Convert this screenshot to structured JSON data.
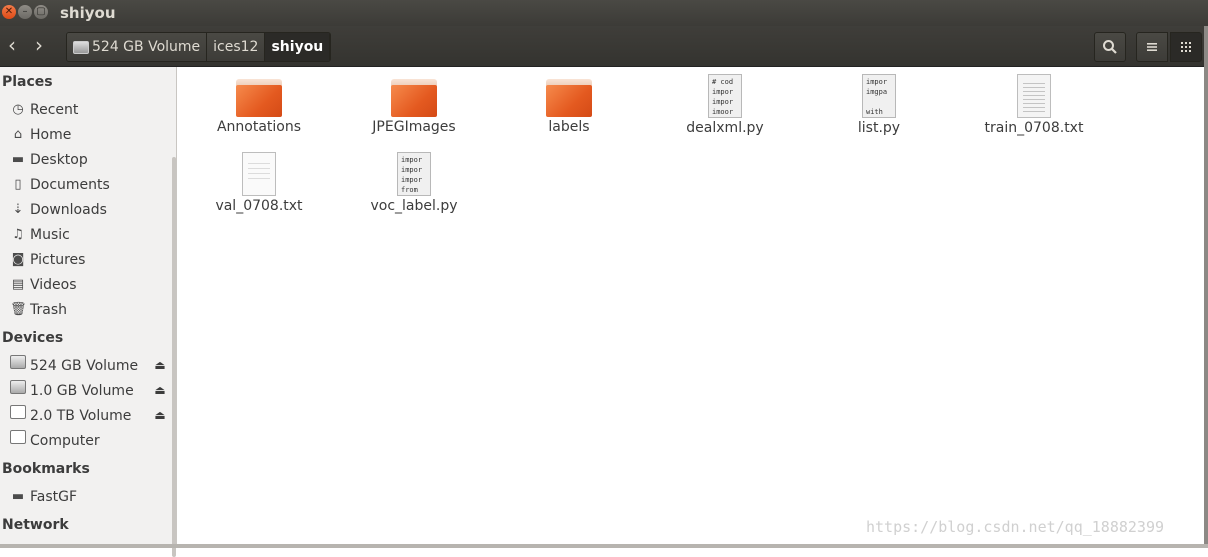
{
  "window": {
    "title": "shiyou"
  },
  "toolbar": {
    "breadcrumbs": [
      "524 GB Volume",
      "ices12",
      "shiyou"
    ]
  },
  "sidebar": {
    "places_header": "Places",
    "places": [
      {
        "label": "Recent",
        "icon": "clock-icon"
      },
      {
        "label": "Home",
        "icon": "home-icon"
      },
      {
        "label": "Desktop",
        "icon": "folder-icon"
      },
      {
        "label": "Documents",
        "icon": "document-icon"
      },
      {
        "label": "Downloads",
        "icon": "download-icon"
      },
      {
        "label": "Music",
        "icon": "music-icon"
      },
      {
        "label": "Pictures",
        "icon": "camera-icon"
      },
      {
        "label": "Videos",
        "icon": "film-icon"
      },
      {
        "label": "Trash",
        "icon": "trash-icon"
      }
    ],
    "devices_header": "Devices",
    "devices": [
      {
        "label": "524 GB Volume",
        "icon": "drive-icon",
        "eject": true
      },
      {
        "label": "1.0 GB Volume",
        "icon": "drive-icon",
        "eject": true
      },
      {
        "label": "2.0 TB Volume",
        "icon": "drive-icon",
        "eject": true
      },
      {
        "label": "Computer",
        "icon": "computer-icon",
        "eject": false
      }
    ],
    "bookmarks_header": "Bookmarks",
    "bookmarks": [
      {
        "label": "FastGF",
        "icon": "folder-icon"
      }
    ],
    "network_header": "Network"
  },
  "files": [
    {
      "name": "Annotations",
      "type": "folder"
    },
    {
      "name": "JPEGImages",
      "type": "folder"
    },
    {
      "name": "labels",
      "type": "folder"
    },
    {
      "name": "dealxml.py",
      "type": "script",
      "preview": [
        "# cod",
        "impor",
        "impor",
        "imoor"
      ]
    },
    {
      "name": "list.py",
      "type": "script",
      "preview": [
        "impor",
        "imgpa",
        "",
        "with"
      ]
    },
    {
      "name": "train_0708.txt",
      "type": "text"
    },
    {
      "name": "val_0708.txt",
      "type": "text"
    },
    {
      "name": "voc_label.py",
      "type": "script",
      "preview": [
        "impor",
        "impor",
        "impor",
        "from"
      ]
    }
  ],
  "watermark": "https://blog.csdn.net/qq_18882399",
  "colors": {
    "accent": "#e45a20",
    "titlebar": "#3c3b37",
    "sidebar": "#f2f1f0"
  }
}
